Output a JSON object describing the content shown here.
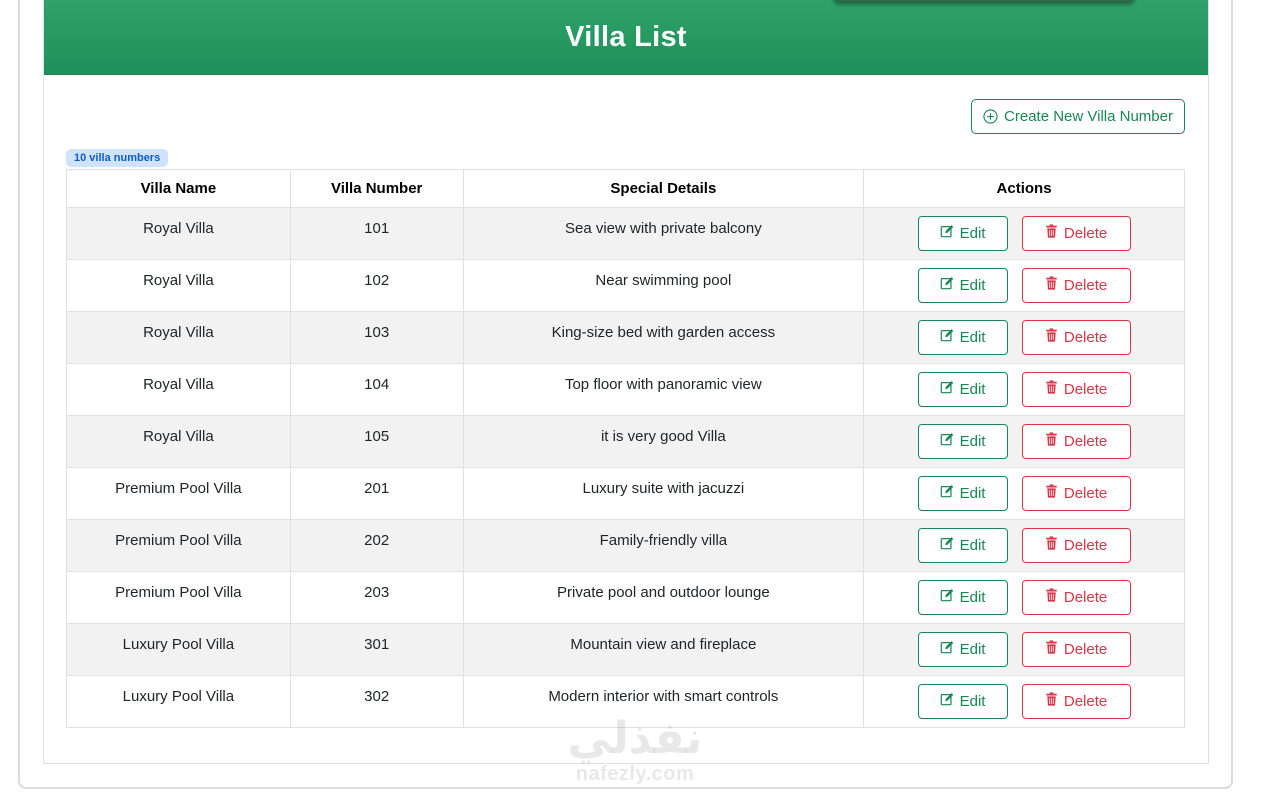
{
  "header": {
    "title": "Villa List"
  },
  "toolbar": {
    "create_label": "Create New Villa Number"
  },
  "badge": {
    "count_text": "10 villa numbers"
  },
  "table": {
    "headers": [
      "Villa Name",
      "Villa Number",
      "Special Details",
      "Actions"
    ],
    "edit_label": "Edit",
    "delete_label": "Delete",
    "rows": [
      {
        "name": "Royal Villa",
        "number": "101",
        "details": "Sea view with private balcony"
      },
      {
        "name": "Royal Villa",
        "number": "102",
        "details": "Near swimming pool"
      },
      {
        "name": "Royal Villa",
        "number": "103",
        "details": "King-size bed with garden access"
      },
      {
        "name": "Royal Villa",
        "number": "104",
        "details": "Top floor with panoramic view"
      },
      {
        "name": "Royal Villa",
        "number": "105",
        "details": "it is very good Villa"
      },
      {
        "name": "Premium Pool Villa",
        "number": "201",
        "details": "Luxury suite with jacuzzi"
      },
      {
        "name": "Premium Pool Villa",
        "number": "202",
        "details": "Family-friendly villa"
      },
      {
        "name": "Premium Pool Villa",
        "number": "203",
        "details": "Private pool and outdoor lounge"
      },
      {
        "name": "Luxury Pool Villa",
        "number": "301",
        "details": "Mountain view and fireplace"
      },
      {
        "name": "Luxury Pool Villa",
        "number": "302",
        "details": "Modern interior with smart controls"
      }
    ]
  },
  "watermark": {
    "arabic": "نفذلي",
    "latin": "nafezly.com"
  },
  "colors": {
    "header_green": "#1f8f5a",
    "success": "#198754",
    "danger": "#dc3545",
    "badge_bg": "#cfe2ff",
    "badge_text": "#0d5ec9",
    "stripe": "#f2f2f2"
  },
  "icons": {
    "create": "plus-circle-icon",
    "edit": "pencil-square-icon",
    "delete": "trash-icon"
  }
}
